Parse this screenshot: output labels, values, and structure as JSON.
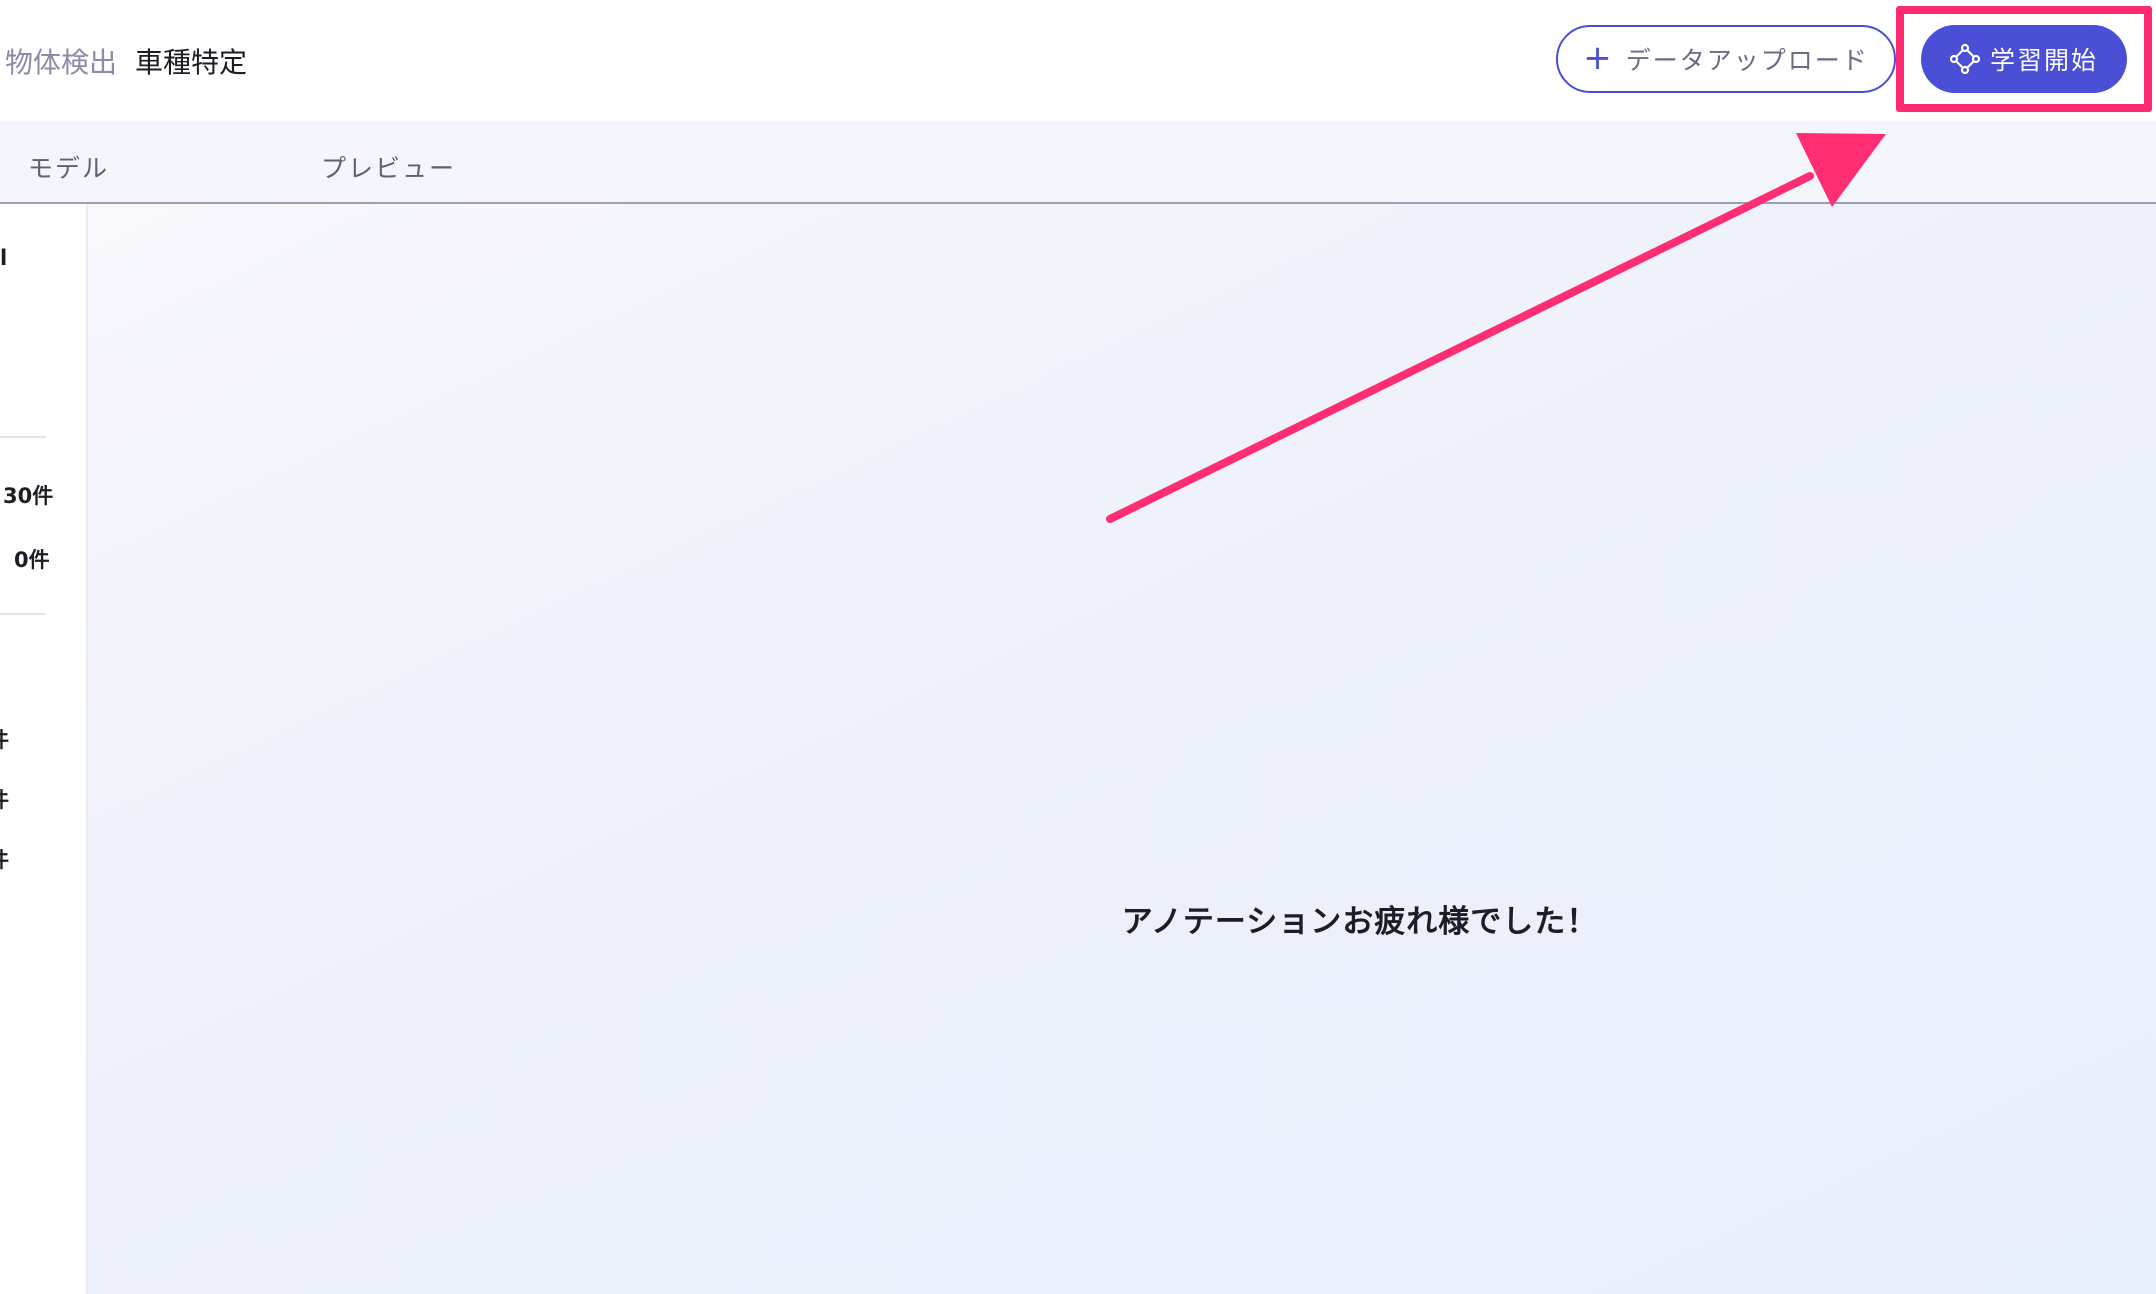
{
  "header": {
    "breadcrumb_parent": "物体検出",
    "breadcrumb_current": "車種特定",
    "upload_button_label": "データアップロード",
    "train_button_label": "学習開始"
  },
  "tabs": [
    {
      "label": "モデル"
    },
    {
      "label": "プレビュー"
    }
  ],
  "sidebar": {
    "top_partial": "l",
    "count_1": "30件",
    "count_2": "0件",
    "count_3": "件",
    "count_4": "件",
    "count_5": "件"
  },
  "main": {
    "message": "アノテーションお疲れ様でした！"
  },
  "colors": {
    "accent": "#4a4fd6",
    "annotation": "#fd2a72",
    "text": "#1d1d26"
  },
  "icons": [
    "plus-icon",
    "network-icon",
    "annotation-arrow"
  ]
}
